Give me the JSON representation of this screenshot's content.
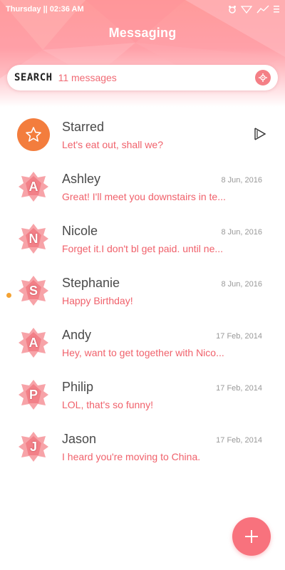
{
  "status_bar": {
    "datetime": "Thursday || 02:36 AM",
    "icons": [
      "alarm-icon",
      "signal-icon",
      "network-icon",
      "menu-icon"
    ]
  },
  "header": {
    "title": "Messaging"
  },
  "search": {
    "label": "SEARCH",
    "count": "11 messages"
  },
  "conversations": [
    {
      "name": "Starred",
      "preview": "Let's eat out, shall we?",
      "date": "",
      "letter": "",
      "type": "starred"
    },
    {
      "name": "Ashley",
      "preview": "Great! I'll meet you downstairs in te...",
      "date": "8 Jun, 2016",
      "letter": "A"
    },
    {
      "name": "Nicole",
      "preview": "Forget it.I don't bl get paid. until ne...",
      "date": "8 Jun, 2016",
      "letter": "N"
    },
    {
      "name": "Stephanie",
      "preview": "Happy Birthday!",
      "date": "8 Jun, 2016",
      "letter": "S",
      "unread": true
    },
    {
      "name": "Andy",
      "preview": "Hey, want to get together with Nico...",
      "date": "17 Feb, 2014",
      "letter": "A"
    },
    {
      "name": "Philip",
      "preview": "LOL, that's so funny!",
      "date": "17 Feb, 2014",
      "letter": "P"
    },
    {
      "name": "Jason",
      "preview": "I heard you're moving to China.",
      "date": "17 Feb, 2014",
      "letter": "J"
    }
  ],
  "fab": {
    "icon": "plus-icon"
  },
  "colors": {
    "accent": "#f0616b",
    "starred": "#f37d3d",
    "unread_dot": "#f4a233",
    "fab": "#f8727d"
  }
}
